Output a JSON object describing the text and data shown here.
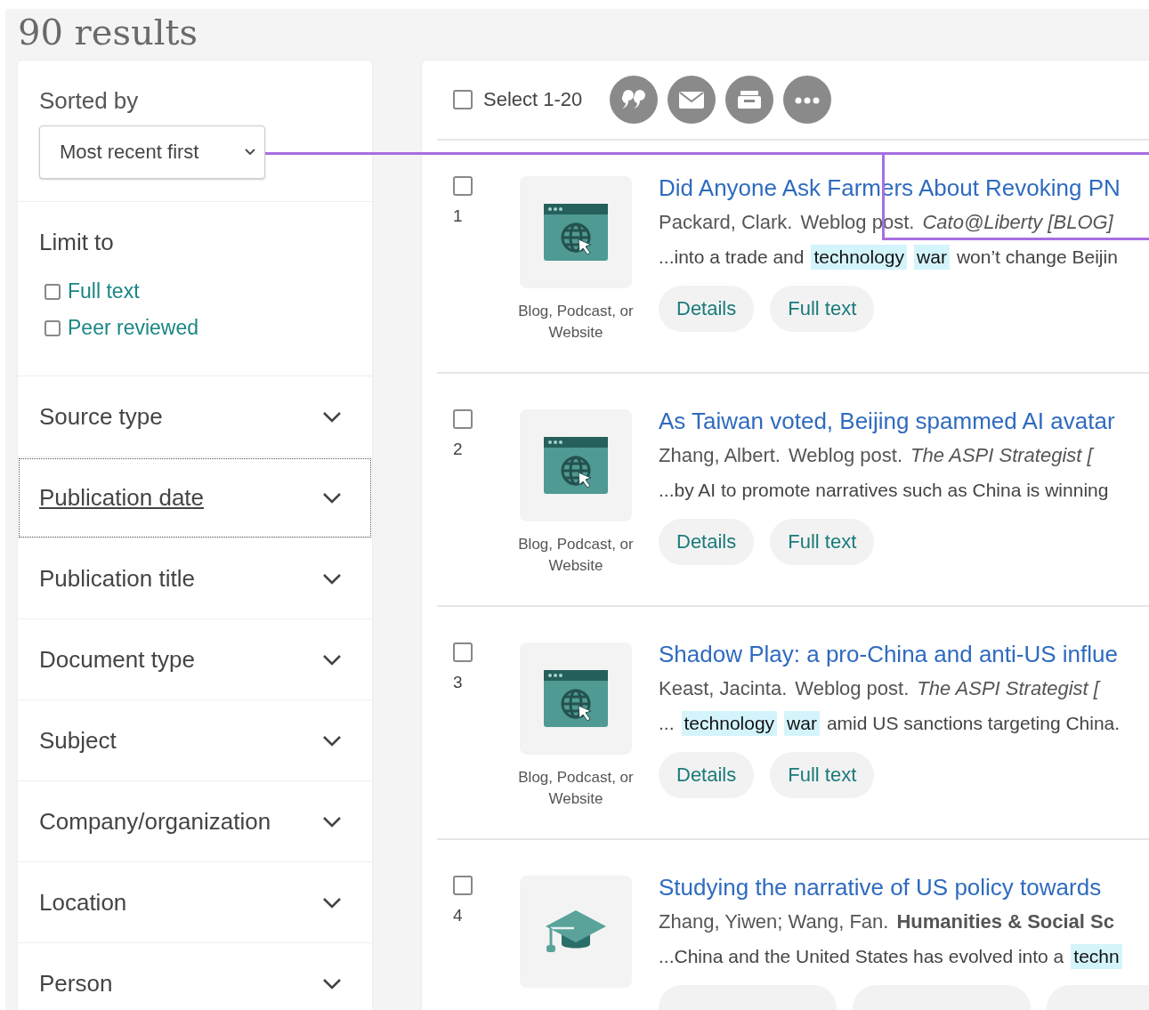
{
  "results_count": "90 results",
  "sort": {
    "label": "Sorted by",
    "value": "Most recent first"
  },
  "limit": {
    "title": "Limit to",
    "options": [
      {
        "label": "Full text",
        "checked": false
      },
      {
        "label": "Peer reviewed",
        "checked": false
      }
    ]
  },
  "facets": [
    {
      "label": "Source type",
      "focused": false
    },
    {
      "label": "Publication date",
      "focused": true
    },
    {
      "label": "Publication title",
      "focused": false
    },
    {
      "label": "Document type",
      "focused": false
    },
    {
      "label": "Subject",
      "focused": false
    },
    {
      "label": "Company/organization",
      "focused": false
    },
    {
      "label": "Location",
      "focused": false
    },
    {
      "label": "Person",
      "focused": false
    }
  ],
  "toolbar": {
    "select_label": "Select 1-20",
    "select_checked": false
  },
  "results": [
    {
      "number": "1",
      "checked": false,
      "kind": "web",
      "type_label": "Blog, Podcast, or Website",
      "title": "Did Anyone Ask Farmers About Revoking PN",
      "authors": "Packard, Clark.",
      "doc_type": "Weblog post.",
      "source": "Cato@Liberty [BLOG]",
      "snippet": [
        {
          "text": "...into a trade and",
          "highlight": false
        },
        {
          "text": "technology",
          "highlight": true
        },
        {
          "text": "war",
          "highlight": true
        },
        {
          "text": "won’t change Beijin",
          "highlight": false
        }
      ],
      "buttons": [
        "Details",
        "Full text"
      ]
    },
    {
      "number": "2",
      "checked": false,
      "kind": "web",
      "type_label": "Blog, Podcast, or Website",
      "title": "As Taiwan voted, Beijing spammed AI avatar",
      "authors": "Zhang, Albert.",
      "doc_type": "Weblog post.",
      "source": "The ASPI Strategist [",
      "snippet": [
        {
          "text": "...by AI to promote narratives such as China is winning",
          "highlight": false
        }
      ],
      "buttons": [
        "Details",
        "Full text"
      ]
    },
    {
      "number": "3",
      "checked": false,
      "kind": "web",
      "type_label": "Blog, Podcast, or Website",
      "title": "Shadow Play: a pro-China and anti-US influe",
      "authors": "Keast, Jacinta.",
      "doc_type": "Weblog post.",
      "source": "The ASPI Strategist [",
      "snippet": [
        {
          "text": "...",
          "highlight": false
        },
        {
          "text": "technology",
          "highlight": true
        },
        {
          "text": "war",
          "highlight": true
        },
        {
          "text": "amid US sanctions targeting China.",
          "highlight": false
        }
      ],
      "buttons": [
        "Details",
        "Full text"
      ]
    },
    {
      "number": "4",
      "checked": false,
      "kind": "scholarly",
      "title": "Studying the narrative of US policy towards",
      "authors": "Zhang, Yiwen; Wang, Fan.",
      "source": "Humanities & Social Sc",
      "snippet": [
        {
          "text": "...China and the United States has evolved into a",
          "highlight": false
        },
        {
          "text": "techn",
          "highlight": true
        }
      ]
    }
  ]
}
